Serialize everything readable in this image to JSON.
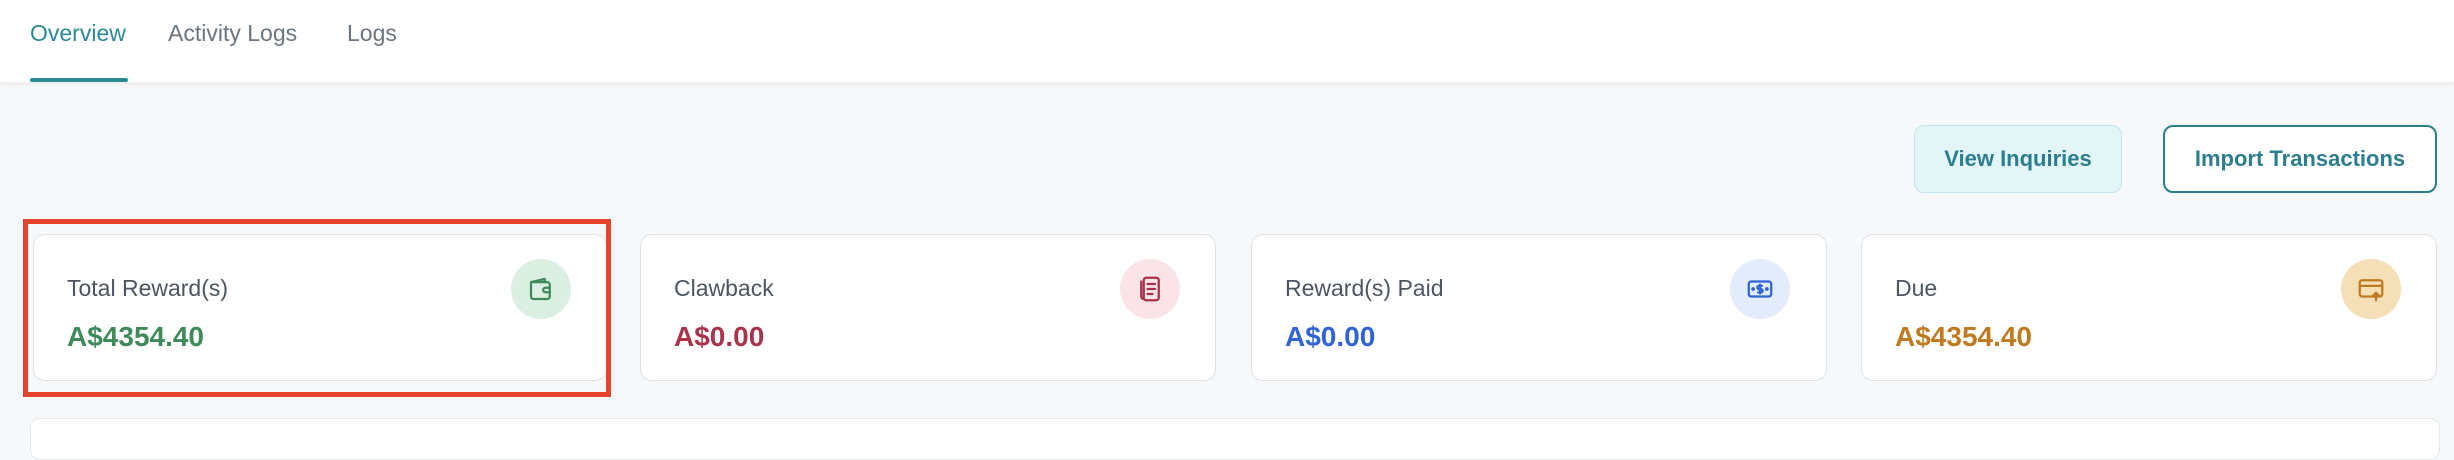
{
  "tabs": [
    {
      "label": "Overview",
      "active": true
    },
    {
      "label": "Activity Logs",
      "active": false
    },
    {
      "label": "Logs",
      "active": false
    }
  ],
  "actions": {
    "view_inquiries": "View Inquiries",
    "import_transactions": "Import Transactions"
  },
  "cards": [
    {
      "label": "Total Reward(s)",
      "value": "A$4354.40",
      "icon": "wallet-icon",
      "value_color": "#3f8a5a",
      "icon_bg": "#dcefe3",
      "highlighted": true
    },
    {
      "label": "Clawback",
      "value": "A$0.00",
      "icon": "document-icon",
      "value_color": "#a8334a",
      "icon_bg": "#fbe4e8"
    },
    {
      "label": "Reward(s) Paid",
      "value": "A$0.00",
      "icon": "money-icon",
      "value_color": "#2f63d6",
      "icon_bg": "#e3ecfb"
    },
    {
      "label": "Due",
      "value": "A$4354.40",
      "icon": "card-upload-icon",
      "value_color": "#bf7a20",
      "icon_bg": "#f4dfb6"
    }
  ]
}
